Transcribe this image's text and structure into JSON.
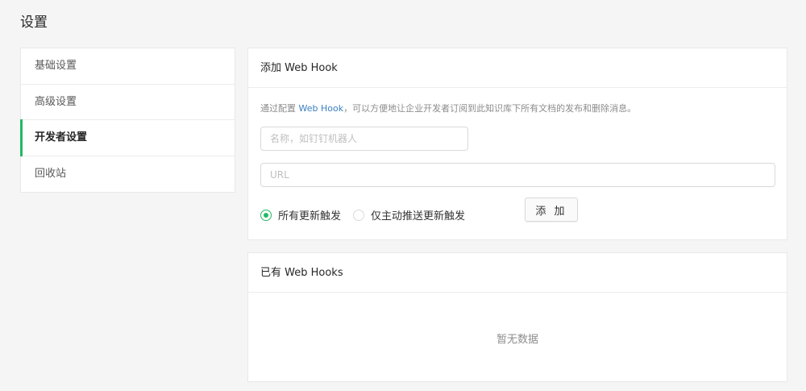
{
  "page": {
    "title": "设置"
  },
  "sidebar": {
    "items": [
      {
        "label": "基础设置"
      },
      {
        "label": "高级设置"
      },
      {
        "label": "开发者设置"
      },
      {
        "label": "回收站"
      }
    ],
    "active_index": 2
  },
  "add_webhook": {
    "title": "添加 Web Hook",
    "desc_prefix": "通过配置 ",
    "desc_link": "Web Hook",
    "desc_suffix": "，可以方便地让企业开发者订阅到此知识库下所有文档的发布和删除消息。",
    "name_input": {
      "placeholder": "名称，如钉钉机器人",
      "value": ""
    },
    "url_input": {
      "placeholder": "URL",
      "value": ""
    },
    "radio_all": {
      "label": "所有更新触发",
      "checked": true
    },
    "radio_push": {
      "label": "仅主动推送更新触发",
      "checked": false
    },
    "add_button": "添 加"
  },
  "webhook_list": {
    "title": "已有 Web Hooks",
    "empty_text": "暂无数据"
  },
  "colors": {
    "accent": "#25b864",
    "link": "#3a7fc1",
    "background": "#f5f5f5"
  }
}
